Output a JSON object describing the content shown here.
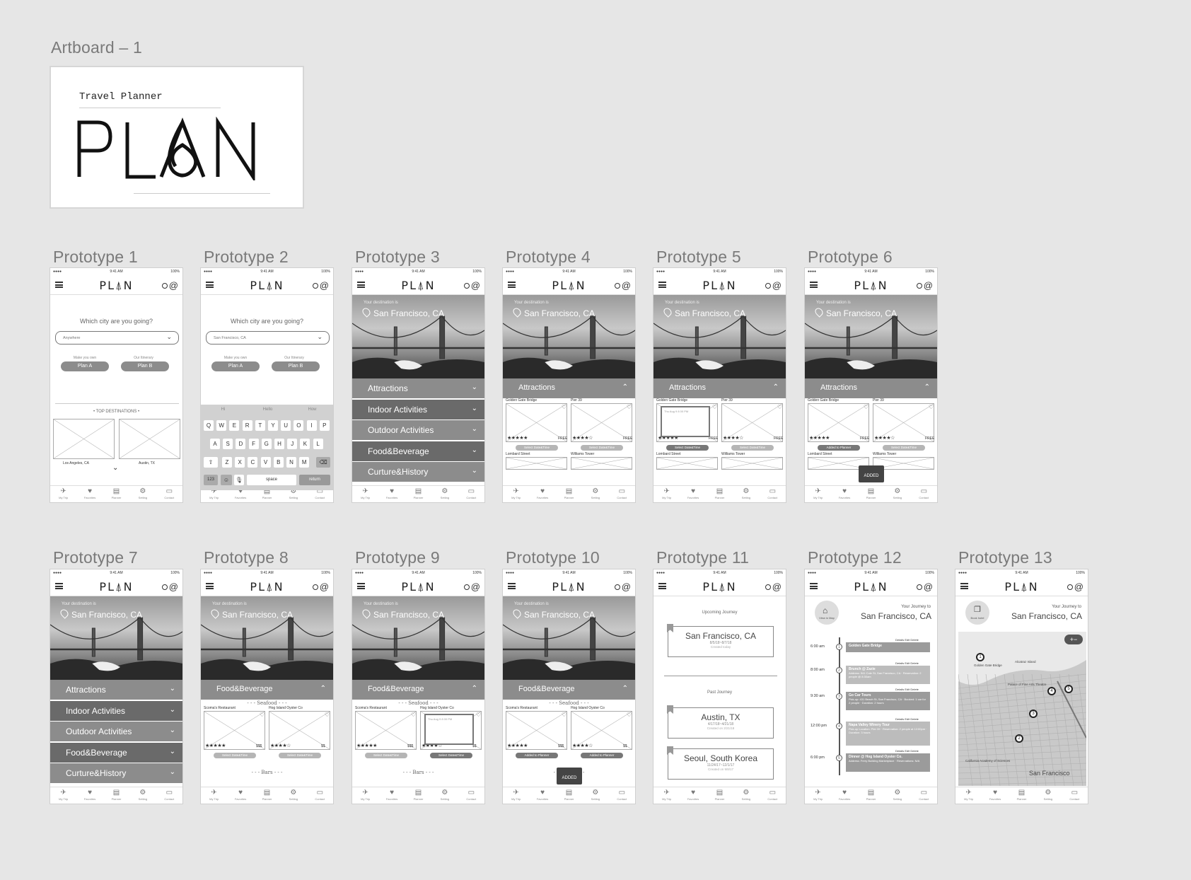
{
  "artboard": {
    "label": "Artboard – 1",
    "tagline": "Travel Planner",
    "logo_text": "PLAN"
  },
  "brand": "PL⍋N",
  "status": {
    "time": "9:41 AM",
    "battery": "100%",
    "signal": "●●●●"
  },
  "tabs": [
    {
      "icon": "airplane-icon",
      "glyph": "✈",
      "label": "My Trip"
    },
    {
      "icon": "heart-icon",
      "glyph": "♥",
      "label": "Favorites"
    },
    {
      "icon": "planner-icon",
      "glyph": "▤",
      "label": "Planner"
    },
    {
      "icon": "gear-icon",
      "glyph": "⚙",
      "label": "Setting"
    },
    {
      "icon": "chat-icon",
      "glyph": "▭",
      "label": "Contact"
    }
  ],
  "prototypes": [
    {
      "label": "Prototype 1"
    },
    {
      "label": "Prototype 2"
    },
    {
      "label": "Prototype 3"
    },
    {
      "label": "Prototype 4"
    },
    {
      "label": "Prototype 5"
    },
    {
      "label": "Prototype 6"
    },
    {
      "label": "Prototype 7"
    },
    {
      "label": "Prototype 8"
    },
    {
      "label": "Prototype 9"
    },
    {
      "label": "Prototype 10"
    },
    {
      "label": "Prototype 11"
    },
    {
      "label": "Prototype 12"
    },
    {
      "label": "Prototype 13"
    }
  ],
  "home": {
    "question": "Which city are you going?",
    "select_default": "Anywhere",
    "select_filled": "San Francisco, CA",
    "make_own": "Make you own",
    "our_itinerary": "Our Itinerary",
    "plan_a": "Plan A",
    "plan_b": "Plan B",
    "top_destinations": "• TOP DESTINATIONS •",
    "dest1": "Los Angeles, CA",
    "dest2": "Austin, TX"
  },
  "keyboard": {
    "suggestions": [
      "Hi",
      "Hello",
      "How"
    ],
    "row1": [
      "Q",
      "W",
      "E",
      "R",
      "T",
      "Y",
      "U",
      "O",
      "I",
      "P"
    ],
    "row2": [
      "A",
      "S",
      "D",
      "F",
      "G",
      "H",
      "J",
      "K",
      "L"
    ],
    "row3": [
      "Z",
      "X",
      "C",
      "V",
      "B",
      "N",
      "M"
    ],
    "num": "123",
    "space": "space",
    "return": "return"
  },
  "hero": {
    "sub": "Your destination is",
    "city": "San Francisco, CA"
  },
  "categories": [
    "Attractions",
    "Indoor Activities",
    "Outdoor Activities",
    "Food&Beverage",
    "Curture&History"
  ],
  "attractions": {
    "header": "Attractions",
    "items": [
      "Golden Gate Bridge",
      "Pier 39",
      "Lombard Street",
      "Williams Tower"
    ],
    "free": "FREE",
    "select": "Select Date&Time",
    "added_planner": "Added to Planner",
    "added": "ADDED"
  },
  "food": {
    "header": "Food&Beverage",
    "section": "- - - Seafood - - -",
    "section2": "- - - Bars - - -",
    "items": [
      "Scoma's Restaurant",
      "Hog Island Oyster Co"
    ],
    "price1": "$$$",
    "price2": "$$"
  },
  "journeys": {
    "upcoming": "Upcoming Journey",
    "past": "Past Journey",
    "list": [
      {
        "city": "San Francisco, CA",
        "dates": "8/5/18~8/7/18",
        "created": "Created today"
      },
      {
        "city": "Austin, TX",
        "dates": "4/17/18~4/21/18",
        "created": "Created on 2/21/18"
      },
      {
        "city": "Seoul, South Korea",
        "dates": "11/24/17~12/1/17",
        "created": "Created on 9/8/17"
      }
    ]
  },
  "itinerary": {
    "heading": "Your Journey to",
    "city": "San Francisco, CA",
    "view_map": "View in Map",
    "book_hotel": "Book hotel",
    "actions": "Details   Edit   Delete",
    "stops": [
      {
        "time": "6:00 am",
        "n": "1",
        "title": "Golden Gate Bridge",
        "detail": ""
      },
      {
        "time": "8:00 am",
        "n": "2",
        "title": "Brunch @ Zazie",
        "detail": "Address: 941 Cole St, San Francisco, CA · Reservation: 2 people @ 8:30am"
      },
      {
        "time": "9:30 am",
        "n": "3",
        "title": "Go Car Tours",
        "detail": "Pick-up: 431 Beach St, San Francisco, CA · Booked: 1 car for 2 people · Duration: 2 hours"
      },
      {
        "time": "12:00 pm",
        "n": "4",
        "title": "Napa Valley Winery Tour",
        "detail": "Pick-up Location: Pier 39 · Reservation: 2 people at 12:00pm · Duration: 3 hours"
      },
      {
        "time": "6:00 pm",
        "n": "5",
        "title": "Dinner @ Hog Island Oyster Co.",
        "detail": "Address: Ferry Building Marketplace · Reservations: N/A"
      }
    ]
  },
  "map": {
    "labels": [
      "Golden Gate Bridge",
      "Alcatraz Island",
      "Palace of Fine Arts Theatre",
      "California Academy of Sciences",
      "San Francisco"
    ],
    "pins": [
      "1",
      "2",
      "3",
      "4",
      "5"
    ]
  }
}
